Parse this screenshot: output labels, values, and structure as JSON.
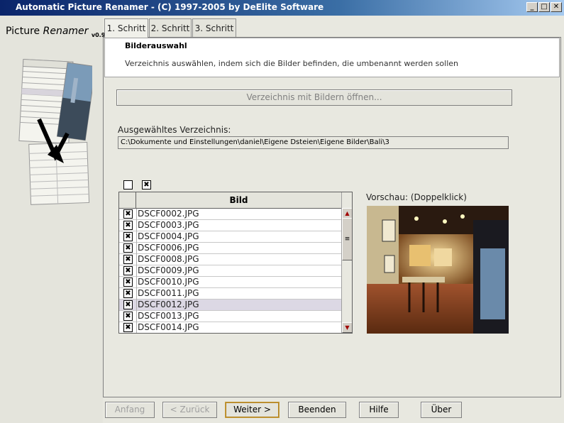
{
  "window": {
    "title": "Automatic Picture Renamer - (C) 1997-2005 by DeElite Software",
    "min_icon": "minimize-icon",
    "max_icon": "maximize-icon",
    "close_icon": "close-icon"
  },
  "logo": {
    "word1": "Picture",
    "word2": "Renamer",
    "version": "v0.9"
  },
  "tabs": [
    {
      "label": "1. Schritt",
      "active": true
    },
    {
      "label": "2. Schritt",
      "active": false
    },
    {
      "label": "3. Schritt",
      "active": false
    }
  ],
  "step": {
    "title": "Bilderauswahl",
    "description": "Verzeichnis auswählen, indem sich die Bilder befinden, die umbenannt werden sollen"
  },
  "open_button": "Verzeichnis mit Bildern öffnen...",
  "dir_label": "Ausgewähltes Verzeichnis:",
  "dir_value": "C:\\Dokumente und Einstellungen\\daniel\\Eigene Dsteien\\Eigene Bilder\\Bali\\3",
  "select_none_mark": "",
  "select_all_mark": "✖",
  "table": {
    "header": "Bild",
    "rows": [
      {
        "name": "DSCF0002.JPG",
        "checked": true,
        "mark": "✖",
        "selected": false
      },
      {
        "name": "DSCF0003.JPG",
        "checked": true,
        "mark": "✖",
        "selected": false
      },
      {
        "name": "DSCF0004.JPG",
        "checked": true,
        "mark": "✖",
        "selected": false
      },
      {
        "name": "DSCF0006.JPG",
        "checked": true,
        "mark": "✖",
        "selected": false
      },
      {
        "name": "DSCF0008.JPG",
        "checked": true,
        "mark": "✖",
        "selected": false
      },
      {
        "name": "DSCF0009.JPG",
        "checked": true,
        "mark": "✖",
        "selected": false
      },
      {
        "name": "DSCF0010.JPG",
        "checked": true,
        "mark": "✖",
        "selected": false
      },
      {
        "name": "DSCF0011.JPG",
        "checked": true,
        "mark": "✖",
        "selected": false
      },
      {
        "name": "DSCF0012.JPG",
        "checked": true,
        "mark": "✖",
        "selected": true
      },
      {
        "name": "DSCF0013.JPG",
        "checked": true,
        "mark": "✖",
        "selected": false
      },
      {
        "name": "DSCF0014.JPG",
        "checked": true,
        "mark": "✖",
        "selected": false
      }
    ]
  },
  "preview_label": "Vorschau: (Doppelklick)",
  "nav": {
    "start": "Anfang",
    "back": "< Zurück",
    "next": "Weiter >",
    "finish": "Beenden",
    "help": "Hilfe",
    "about": "Über"
  }
}
